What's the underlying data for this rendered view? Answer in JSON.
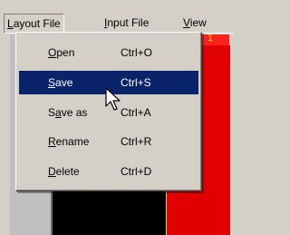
{
  "menubar": {
    "items": [
      {
        "label": "Layout File",
        "mnemonic": "L",
        "rest": "ayout File"
      },
      {
        "label": "Input File",
        "mnemonic": "I",
        "rest": "nput File"
      },
      {
        "label": "View",
        "mnemonic": "V",
        "rest": "iew"
      }
    ]
  },
  "dropdown": {
    "items": [
      {
        "pre": "",
        "mnemonic": "O",
        "rest": "pen",
        "shortcut": "Ctrl+O"
      },
      {
        "pre": "",
        "mnemonic": "S",
        "rest": "ave",
        "shortcut": "Ctrl+S",
        "selected": true
      },
      {
        "pre": "S",
        "mnemonic": "a",
        "rest": "ve as",
        "shortcut": "Ctrl+A"
      },
      {
        "pre": "",
        "mnemonic": "R",
        "rest": "ename",
        "shortcut": "Ctrl+R"
      },
      {
        "pre": "",
        "mnemonic": "D",
        "rest": "elete",
        "shortcut": "Ctrl+D"
      }
    ]
  },
  "canvas": {
    "label_number": "1"
  },
  "colors": {
    "selection": "#0a246a",
    "menu_bg": "#d4d0c8",
    "red_panel": "#e00000",
    "black_panel": "#000000"
  }
}
